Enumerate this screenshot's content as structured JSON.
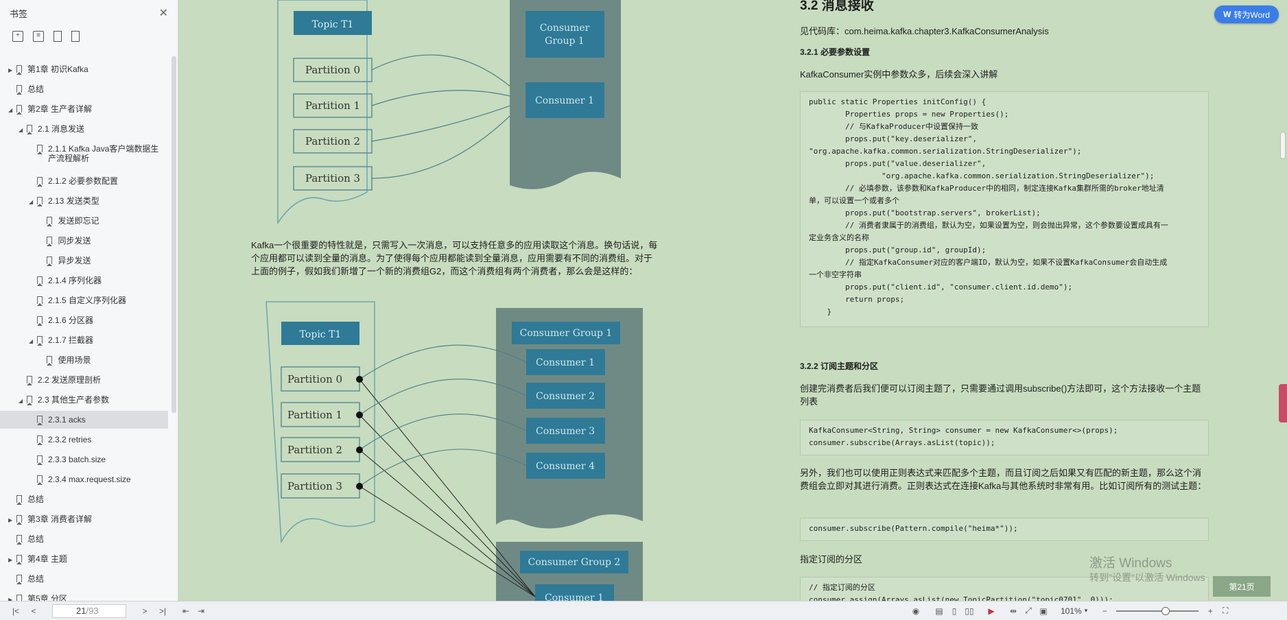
{
  "sidebar": {
    "title": "书签",
    "close_icon": "close-icon",
    "tools": [
      "add-bookmark-icon",
      "outline-icon",
      "bookmark-icon",
      "bookmark-outline-icon"
    ],
    "items": [
      {
        "label": "第1章 初识Kafka",
        "level": 0,
        "arrow": "right"
      },
      {
        "label": "总结",
        "level": 0,
        "arrow": ""
      },
      {
        "label": "第2章 生产者详解",
        "level": 0,
        "arrow": "down"
      },
      {
        "label": "2.1 消息发送",
        "level": 1,
        "arrow": "down"
      },
      {
        "label": "2.1.1 Kafka Java客户端数据生产流程解析",
        "level": 2,
        "arrow": ""
      },
      {
        "label": "2.1.2 必要参数配置",
        "level": 2,
        "arrow": ""
      },
      {
        "label": "2.13 发送类型",
        "level": 2,
        "arrow": "down"
      },
      {
        "label": "发送即忘记",
        "level": 3,
        "arrow": ""
      },
      {
        "label": "同步发送",
        "level": 3,
        "arrow": ""
      },
      {
        "label": "异步发送",
        "level": 3,
        "arrow": ""
      },
      {
        "label": "2.1.4 序列化器",
        "level": 2,
        "arrow": ""
      },
      {
        "label": "2.1.5 自定义序列化器",
        "level": 2,
        "arrow": ""
      },
      {
        "label": "2.1.6 分区器",
        "level": 2,
        "arrow": ""
      },
      {
        "label": "2.1.7 拦截器",
        "level": 2,
        "arrow": "down"
      },
      {
        "label": "使用场景",
        "level": 3,
        "arrow": ""
      },
      {
        "label": "2.2 发送原理剖析",
        "level": 1,
        "arrow": ""
      },
      {
        "label": "2.3 其他生产者参数",
        "level": 1,
        "arrow": "down"
      },
      {
        "label": "2.3.1 acks",
        "level": 2,
        "arrow": "",
        "selected": true
      },
      {
        "label": "2.3.2 retries",
        "level": 2,
        "arrow": ""
      },
      {
        "label": "2.3.3 batch.size",
        "level": 2,
        "arrow": ""
      },
      {
        "label": "2.3.4 max.request.size",
        "level": 2,
        "arrow": ""
      },
      {
        "label": "总结",
        "level": 0,
        "arrow": ""
      },
      {
        "label": "第3章 消费者详解",
        "level": 0,
        "arrow": "right"
      },
      {
        "label": "总结",
        "level": 0,
        "arrow": ""
      },
      {
        "label": "第4章  主题",
        "level": 0,
        "arrow": "right"
      },
      {
        "label": "总结",
        "level": 0,
        "arrow": ""
      },
      {
        "label": "第5章 分区",
        "level": 0,
        "arrow": "right"
      }
    ]
  },
  "left_page": {
    "diagram1": {
      "topic": "Topic T1",
      "partitions": [
        "Partition 0",
        "Partition 1",
        "Partition 2",
        "Partition 3"
      ],
      "group": "Consumer Group 1",
      "consumer": "Consumer 1"
    },
    "paragraph": "Kafka一个很重要的特性就是，只需写入一次消息，可以支持任意多的应用读取这个消息。换句话说，每个应用都可以读到全量的消息。为了使得每个应用都能读到全量消息，应用需要有不同的消费组。对于上面的例子，假如我们新增了一个新的消费组G2，而这个消费组有两个消费者，那么会是这样的：",
    "diagram2": {
      "topic": "Topic T1",
      "partitions": [
        "Partition 0",
        "Partition 1",
        "Partition 2",
        "Partition 3"
      ],
      "group1": "Consumer Group 1",
      "consumers1": [
        "Consumer 1",
        "Consumer 2",
        "Consumer 3",
        "Consumer 4"
      ],
      "group2": "Consumer Group 2",
      "consumers2": [
        "Consumer 1"
      ]
    }
  },
  "right_page": {
    "section_title": "3.2 消息接收",
    "repo": "见代码库：com.heima.kafka.chapter3.KafkaConsumerAnalysis",
    "sub1": "3.2.1 必要参数设置",
    "sub1_text": "KafkaConsumer实例中参数众多，后续会深入讲解",
    "code1": "public static Properties initConfig() {\n        Properties props = new Properties();\n        // 与KafkaProducer中设置保持一致\n        props.put(\"key.deserializer\",\n\"org.apache.kafka.common.serialization.StringDeserializer\");\n        props.put(\"value.deserializer\",\n                \"org.apache.kafka.common.serialization.StringDeserializer\");\n        // 必填参数，该参数和KafkaProducer中的相同，制定连接Kafka集群所需的broker地址清\n单，可以设置一个或者多个\n        props.put(\"bootstrap.servers\", brokerList);\n        // 消费者隶属于的消费组，默认为空，如果设置为空，则会抛出异常，这个参数要设置成具有一\n定业务含义的名称\n        props.put(\"group.id\", groupId);\n        // 指定KafkaConsumer对应的客户端ID，默认为空，如果不设置KafkaConsumer会自动生成\n一个非空字符串\n        props.put(\"client.id\", \"consumer.client.id.demo\");\n        return props;\n    }",
    "sub2": "3.2.2 订阅主题和分区",
    "sub2_text": "创建完消费者后我们便可以订阅主题了，只需要通过调用subscribe()方法即可，这个方法接收一个主题列表",
    "code2": "KafkaConsumer<String, String> consumer = new KafkaConsumer<>(props);\nconsumer.subscribe(Arrays.asList(topic));",
    "regex_text": "另外，我们也可以使用正则表达式来匹配多个主题，而且订阅之后如果又有匹配的新主题，那么这个消费组会立即对其进行消费。正则表达式在连接Kafka与其他系统时非常有用。比如订阅所有的测试主题：",
    "code3": "consumer.subscribe(Pattern.compile(\"heima*\"));",
    "partition_heading": "指定订阅的分区",
    "code4": "// 指定订阅的分区\nconsumer.assign(Arrays.asList(new TopicPartition(\"topic0701\", 0)));"
  },
  "overlay": {
    "to_word": "转为Word",
    "page_badge": "第21页",
    "watermark_title": "激活 Windows",
    "watermark_sub": "转到\"设置\"以激活 Windows"
  },
  "statusbar": {
    "current_page": "21",
    "total_pages": "/93",
    "zoom": "101%"
  },
  "colors": {
    "accent": "#3b7de8",
    "page_bg": "#c8dcbf",
    "box_fill": "#2f7a96",
    "dark_panel": "#6f8a84"
  }
}
